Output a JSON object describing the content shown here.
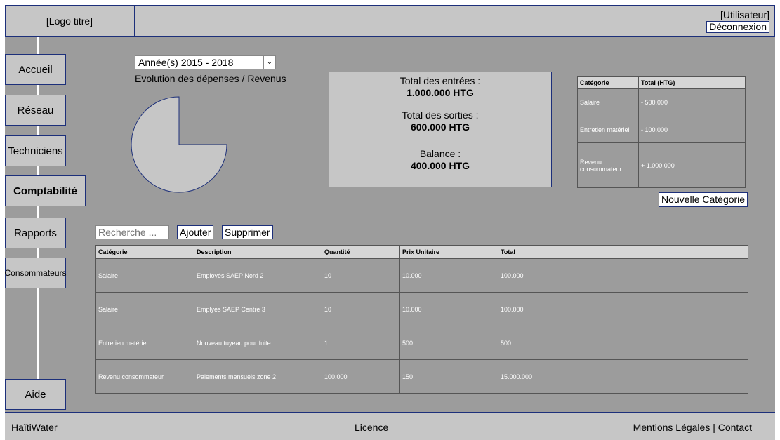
{
  "header": {
    "logo": "[Logo titre]",
    "user": "[Utilisateur]",
    "logout": "Déconnexion"
  },
  "sidebar": {
    "items": [
      {
        "label": "Accueil"
      },
      {
        "label": "Réseau"
      },
      {
        "label": "Techniciens"
      },
      {
        "label": "Comptabilité",
        "active": true
      },
      {
        "label": "Rapports"
      },
      {
        "label": "Consommateurs"
      },
      {
        "label": "Aide"
      }
    ]
  },
  "filter": {
    "year_select": "Année(s) 2015 - 2018"
  },
  "chart_data": {
    "type": "pie",
    "title": "Evolution des dépenses / Revenus",
    "slices": [
      {
        "label": "",
        "value": 75
      },
      {
        "label": "",
        "value": 25
      }
    ]
  },
  "summary": {
    "entries_label": "Total des entrées :",
    "entries_value": "1.000.000 HTG",
    "outputs_label": "Total des sorties :",
    "outputs_value": "600.000 HTG",
    "balance_label": "Balance :",
    "balance_value": "400.000 HTG"
  },
  "category_table": {
    "headers": [
      "Catégorie",
      "Total (HTG)"
    ],
    "rows": [
      [
        "Salaire",
        "- 500.000"
      ],
      [
        "Entretien matériel",
        "- 100.000"
      ],
      [
        "Revenu consommateur",
        "+ 1.000.000"
      ]
    ],
    "new_button": "Nouvelle Catégorie"
  },
  "actions": {
    "search_placeholder": "Recherche ...",
    "add": "Ajouter",
    "delete": "Supprimer"
  },
  "main_table": {
    "headers": [
      "Catégorie",
      "Description",
      "Quantité",
      "Prix Unitaire",
      "Total"
    ],
    "rows": [
      [
        "Salaire",
        "Employés SAEP Nord 2",
        "10",
        "10.000",
        "100.000"
      ],
      [
        "Salaire",
        "Emplyés SAEP Centre 3",
        "10",
        "10.000",
        "100.000"
      ],
      [
        "Entretien matériel",
        "Nouveau tuyeau pour fuite",
        "1",
        "500",
        "500"
      ],
      [
        "Revenu consommateur",
        "Paiements mensuels zone 2",
        "100.000",
        "150",
        "15.000.000"
      ]
    ]
  },
  "footer": {
    "brand": "HaïtiWater",
    "licence": "Licence",
    "legal": "Mentions Légales | Contact"
  },
  "colors": {
    "panel": "#c6c6c6",
    "background": "#9c9c9c",
    "border": "#1c2f7a"
  }
}
